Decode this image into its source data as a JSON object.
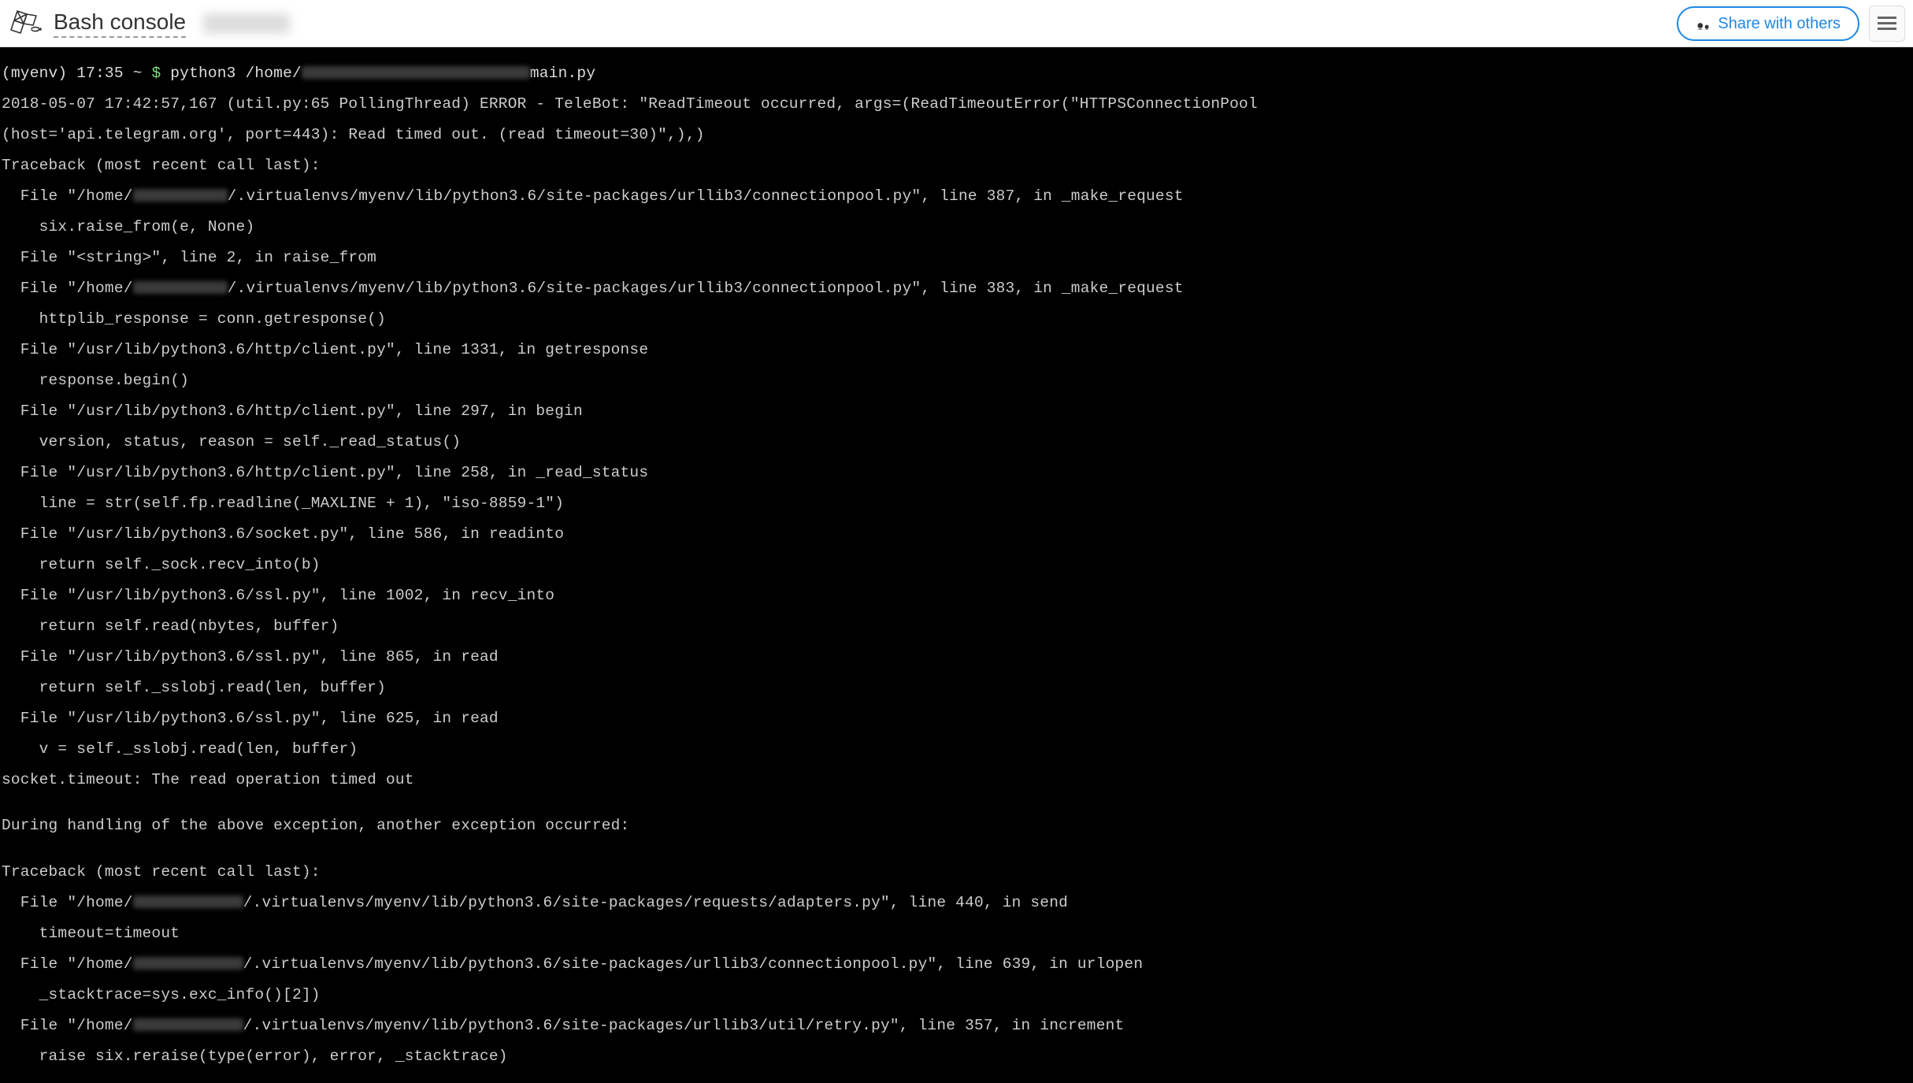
{
  "header": {
    "title": "Bash console",
    "share_button": "Share with others"
  },
  "terminal": {
    "prompt": {
      "env": "(myenv) 17:35 ",
      "tilde": "~ ",
      "dollar": "$ ",
      "cmd_pre": "python3 /home/",
      "cmd_post": "main.py"
    },
    "lines": {
      "l2": "2018-05-07 17:42:57,167 (util.py:65 PollingThread) ERROR - TeleBot: \"ReadTimeout occurred, args=(ReadTimeoutError(\"HTTPSConnectionPool",
      "l3": "(host='api.telegram.org', port=443): Read timed out. (read timeout=30)\",),)",
      "l4": "Traceback (most recent call last):",
      "l5a": "  File \"/home/",
      "l5b": "/.virtualenvs/myenv/lib/python3.6/site-packages/urllib3/connectionpool.py\", line 387, in _make_request",
      "l6": "    six.raise_from(e, None)",
      "l7": "  File \"<string>\", line 2, in raise_from",
      "l8a": "  File \"/home/",
      "l8b": "/.virtualenvs/myenv/lib/python3.6/site-packages/urllib3/connectionpool.py\", line 383, in _make_request",
      "l9": "    httplib_response = conn.getresponse()",
      "l10": "  File \"/usr/lib/python3.6/http/client.py\", line 1331, in getresponse",
      "l11": "    response.begin()",
      "l12": "  File \"/usr/lib/python3.6/http/client.py\", line 297, in begin",
      "l13": "    version, status, reason = self._read_status()",
      "l14": "  File \"/usr/lib/python3.6/http/client.py\", line 258, in _read_status",
      "l15": "    line = str(self.fp.readline(_MAXLINE + 1), \"iso-8859-1\")",
      "l16": "  File \"/usr/lib/python3.6/socket.py\", line 586, in readinto",
      "l17": "    return self._sock.recv_into(b)",
      "l18": "  File \"/usr/lib/python3.6/ssl.py\", line 1002, in recv_into",
      "l19": "    return self.read(nbytes, buffer)",
      "l20": "  File \"/usr/lib/python3.6/ssl.py\", line 865, in read",
      "l21": "    return self._sslobj.read(len, buffer)",
      "l22": "  File \"/usr/lib/python3.6/ssl.py\", line 625, in read",
      "l23": "    v = self._sslobj.read(len, buffer)",
      "l24": "socket.timeout: The read operation timed out",
      "l25": "",
      "l26": "During handling of the above exception, another exception occurred:",
      "l27": "",
      "l28": "Traceback (most recent call last):",
      "l29a": "  File \"/home/",
      "l29b": "/.virtualenvs/myenv/lib/python3.6/site-packages/requests/adapters.py\", line 440, in send",
      "l30": "    timeout=timeout",
      "l31a": "  File \"/home/",
      "l31b": "/.virtualenvs/myenv/lib/python3.6/site-packages/urllib3/connectionpool.py\", line 639, in urlopen",
      "l32": "    _stacktrace=sys.exc_info()[2])",
      "l33a": "  File \"/home/",
      "l33b": "/.virtualenvs/myenv/lib/python3.6/site-packages/urllib3/util/retry.py\", line 357, in increment",
      "l34": "    raise six.reraise(type(error), error, _stacktrace)"
    }
  }
}
